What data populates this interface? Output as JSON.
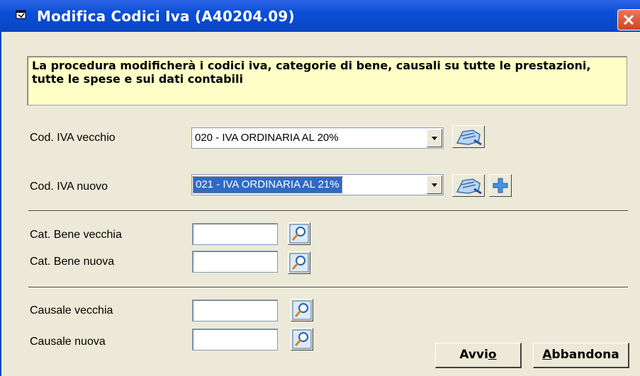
{
  "window": {
    "title": "Modifica Codici Iva (A40204.09)"
  },
  "info": {
    "text": "La procedura modificherà i codici iva, categorie di bene, causali su tutte le prestazioni,  tutte le spese e sui dati contabili"
  },
  "fields": {
    "iva_old_label": "Cod. IVA vecchio",
    "iva_old_value": "020 - IVA ORDINARIA AL 20%",
    "iva_new_label": "Cod. IVA nuovo",
    "iva_new_value": "021 - IVA ORDINARIA AL 21%",
    "cat_old_label": "Cat. Bene vecchia",
    "cat_new_label": "Cat. Bene nuova",
    "caus_old_label": "Causale vecchia",
    "caus_new_label": "Causale nuova"
  },
  "buttons": {
    "avvio_pre": "Avvi",
    "avvio_acc": "o",
    "abbandona_acc": "A",
    "abbandona_post": "bbandona"
  },
  "colors": {
    "titlebar": "#0a44c4",
    "info_bg": "#ffffc8",
    "selection": "#316ac5",
    "close": "#d3461e"
  }
}
